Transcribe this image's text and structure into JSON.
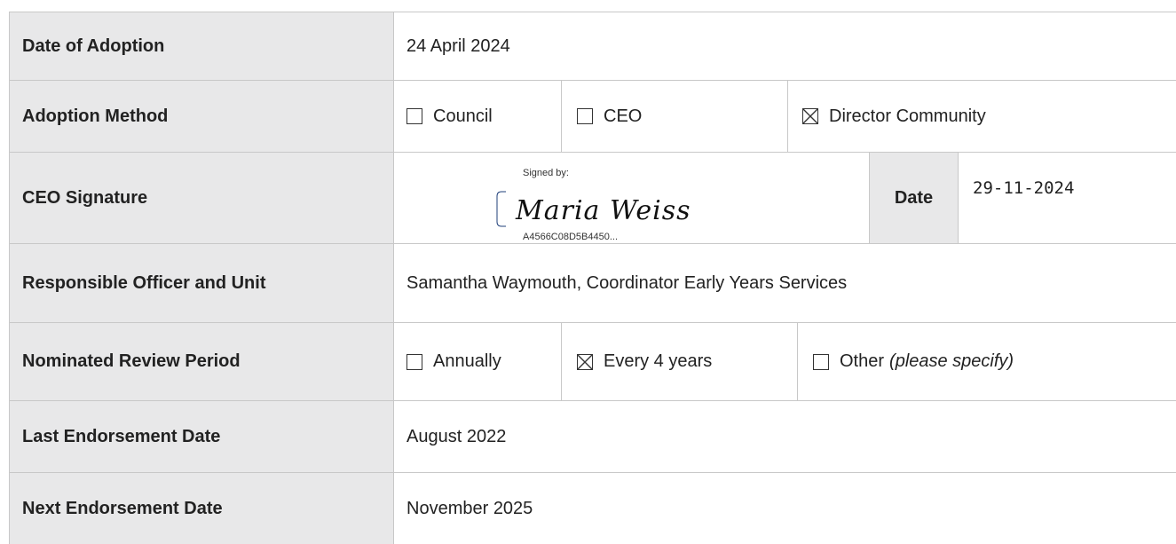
{
  "rows": {
    "date_of_adoption": {
      "label": "Date of Adoption",
      "value": "24 April 2024"
    },
    "adoption_method": {
      "label": "Adoption Method",
      "options": [
        {
          "text": "Council",
          "checked": false
        },
        {
          "text": "CEO",
          "checked": false
        },
        {
          "text": "Director Community",
          "checked": true
        }
      ]
    },
    "ceo_signature": {
      "label": "CEO Signature",
      "signed_by": "Signed by:",
      "signer_name": "Maria Weiss",
      "envelope_id": "A4566C08D5B4450...",
      "date_label": "Date",
      "date_value": "29-11-2024"
    },
    "responsible_officer": {
      "label": "Responsible Officer and Unit",
      "value": "Samantha Waymouth, Coordinator Early Years Services"
    },
    "review_period": {
      "label": "Nominated Review Period",
      "options": [
        {
          "text": "Annually",
          "checked": false
        },
        {
          "text": "Every 4 years",
          "checked": true
        },
        {
          "text": "Other",
          "note": "(please specify)",
          "checked": false
        }
      ]
    },
    "last_endorsement": {
      "label": "Last Endorsement Date",
      "value": "August 2022"
    },
    "next_endorsement": {
      "label": "Next Endorsement Date",
      "value": "November 2025"
    }
  },
  "icons": {
    "unchecked": "checkbox-empty-icon",
    "checked": "checkbox-crossed-icon"
  },
  "colors": {
    "label_bg": "#e8e8e9",
    "border": "#c8c8c8",
    "signature_frame": "#1f3f7a"
  }
}
